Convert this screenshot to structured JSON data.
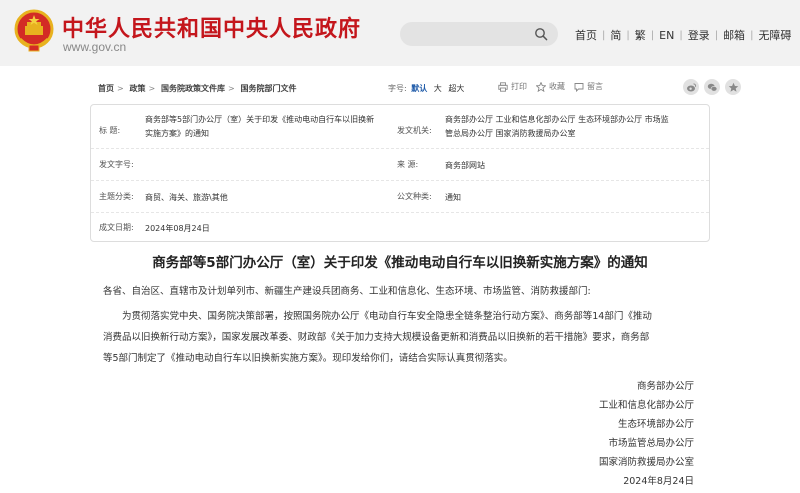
{
  "header": {
    "title": "中华人民共和国中央人民政府",
    "domain": "www.gov.cn",
    "search_placeholder": "",
    "nav": [
      "首页",
      "简",
      "繁",
      "EN",
      "登录",
      "邮箱",
      "无障碍"
    ]
  },
  "toolbar": {
    "breadcrumb": [
      "首页",
      "政策",
      "国务院政策文件库",
      "国务院部门文件"
    ],
    "font_label": "字号:",
    "font_sizes": [
      "默认",
      "大",
      "超大"
    ],
    "actions": [
      "打印",
      "收藏",
      "留言"
    ]
  },
  "meta": {
    "title_label": "标      题:",
    "title_value_line1": "商务部等5部门办公厅（室）关于印发《推动电动自行车以旧换新",
    "title_value_line2": "实施方案》的通知",
    "issuer_label": "发文机关:",
    "issuer_value_line1": "商务部办公厅  工业和信息化部办公厅  生态环境部办公厅  市场监",
    "issuer_value_line2": "管总局办公厅  国家消防救援局办公室",
    "docno_label": "发文字号:",
    "docno_value": "",
    "source_label": "来      源:",
    "source_value": "商务部网站",
    "topic_label": "主题分类:",
    "topic_value": "商贸、海关、旅游\\其他",
    "type_label": "公文种类:",
    "type_value": "通知",
    "date_label": "成文日期:",
    "date_value": "2024年08月24日"
  },
  "article": {
    "title": "商务部等5部门办公厅（室）关于印发《推动电动自行车以旧换新实施方案》的通知",
    "salutation": "各省、自治区、直辖市及计划单列市、新疆生产建设兵团商务、工业和信息化、生态环境、市场监管、消防救援部门:",
    "para1": "为贯彻落实党中央、国务院决策部署，按照国务院办公厅《电动自行车安全隐患全链条整治行动方案》、商务部等14部门《推动",
    "para2": "消费品以旧换新行动方案》，国家发展改革委、财政部《关于加力支持大规模设备更新和消费品以旧换新的若干措施》要求，商务部",
    "para3": "等5部门制定了《推动电动自行车以旧换新实施方案》。现印发给你们，请结合实际认真贯彻落实。",
    "signatories": [
      "商务部办公厅",
      "工业和信息化部办公厅",
      "生态环境部办公厅",
      "市场监管总局办公厅",
      "国家消防救援局办公室"
    ],
    "date": "2024年8月24日"
  },
  "colors": {
    "brand_red": "#c4161c",
    "link_blue": "#1e5aa8",
    "header_bg": "#f2f2f2"
  }
}
